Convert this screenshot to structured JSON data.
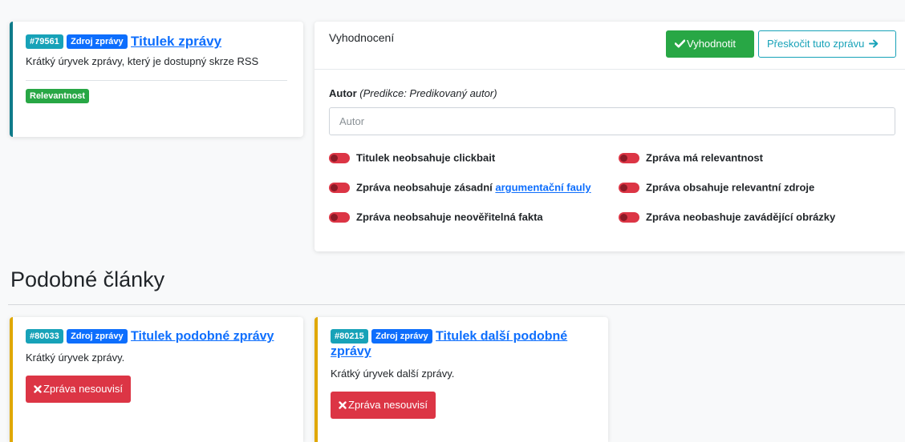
{
  "main_article": {
    "id_badge": "#79561",
    "source_badge": "Zdroj zprávy",
    "title": "Titulek zprávy",
    "excerpt": "Krátký úryvek zprávy, který je dostupný skrze RSS",
    "relevance_badge": "Relevantnost"
  },
  "evaluation": {
    "heading": "Vyhodnocení",
    "evaluate_button": "Vyhodnotit",
    "skip_button": "Přeskočit tuto zprávu",
    "author_label": "Autor",
    "author_prediction": "(Predikce: Predikovaný autor)",
    "author_placeholder": "Autor",
    "toggles_left": [
      {
        "text": "Titulek neobsahuje clickbait"
      },
      {
        "text_before": "Zpráva neobsahuje zásadní ",
        "link": "argumentační fauly"
      },
      {
        "text": "Zpráva neobsahuje neověřitelná fakta"
      }
    ],
    "toggles_right": [
      {
        "text": "Zpráva má relevantnost"
      },
      {
        "text": "Zpráva obsahuje relevantní zdroje"
      },
      {
        "text": "Zpráva neobashuje zavádějící obrázky"
      }
    ]
  },
  "similar": {
    "heading": "Podobné články",
    "articles": [
      {
        "id_badge": "#80033",
        "source_badge": "Zdroj zprávy",
        "title": "Titulek podobné zprávy",
        "excerpt": "Krátký úryvek zprávy.",
        "unrelated_button": "Zpráva nesouvisí"
      },
      {
        "id_badge": "#80215",
        "source_badge": "Zdroj zprávy",
        "title": "Titulek další podobné zprávy",
        "excerpt": "Krátký úryvek další zprávy.",
        "unrelated_button": "Zpráva nesouvisí"
      }
    ]
  },
  "colors": {
    "teal_accent": "#0f7b8a",
    "yellow_accent": "#e0a800",
    "success": "#28a745",
    "danger": "#dc3545",
    "info": "#17a2b8",
    "primary": "#0d6efd"
  },
  "icons": {
    "evaluate": "check-icon",
    "skip": "arrow-right-icon",
    "unrelated": "x-icon"
  }
}
